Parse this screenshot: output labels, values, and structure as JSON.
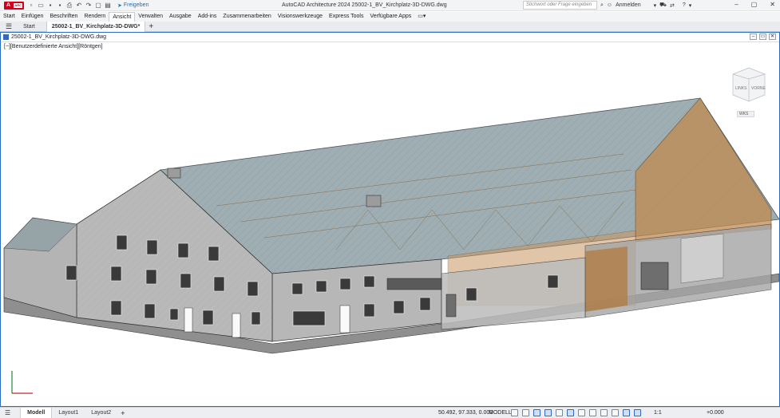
{
  "app": {
    "logo_text": "A",
    "logo_tag": "ARC",
    "window_title": "AutoCAD Architecture 2024   25002-1_BV_Kirchplatz-3D-DWG.dwg",
    "share_label": "Freigeben",
    "search_placeholder": "Stichwort oder Frage eingeben",
    "user_label": "Anmelden",
    "help_label": "?"
  },
  "menu": [
    "Start",
    "Einfügen",
    "Beschriften",
    "Rendern",
    "Ansicht",
    "Verwalten",
    "Ausgabe",
    "Add-ins",
    "Zusammenarbeiten",
    "Visionswerkzeuge",
    "Express Tools",
    "Verfügbare Apps"
  ],
  "menu_active": "Ansicht",
  "tabs": {
    "start": "Start",
    "active": "25002-1_BV_Kirchplatz-3D-DWG*"
  },
  "drawing": {
    "window_title": "25002-1_BV_Kirchplatz-3D-DWG.dwg",
    "viewport_label": "[−][Benutzerdefinierte Ansicht][Röntgen]",
    "viewcube": {
      "face_left": "LINKS",
      "face_front": "VORNE"
    },
    "wcs_label": "WKS"
  },
  "status": {
    "layouts": [
      "Modell",
      "Layout1",
      "Layout2"
    ],
    "coords": "50.492, 97.333, 0.000",
    "space": "MODELL",
    "scale": "1:1",
    "annot_value": "+0.000"
  },
  "colors": {
    "accent": "#2d6cc0",
    "brand": "#d0021b",
    "wall": "#b7b7b7",
    "roof_glass": "#8fa1a5",
    "timber": "#c08a4e"
  }
}
